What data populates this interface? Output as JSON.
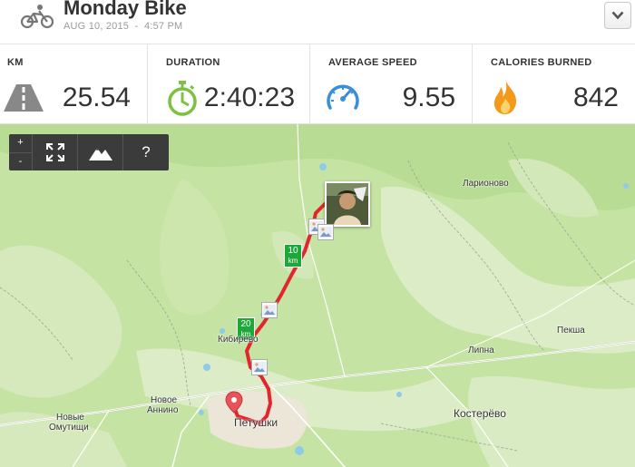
{
  "header": {
    "title": "Monday Bike",
    "date": "AUG 10, 2015",
    "separator": "-",
    "time": "4:57 PM"
  },
  "stats": [
    {
      "label": "KM",
      "value": "25.54",
      "icon": "road-icon"
    },
    {
      "label": "DURATION",
      "value": "2:40:23",
      "icon": "stopwatch-icon"
    },
    {
      "label": "AVERAGE SPEED",
      "value": "9.55",
      "icon": "speedometer-icon"
    },
    {
      "label": "CALORIES BURNED",
      "value": "842",
      "icon": "flame-icon"
    }
  ],
  "map": {
    "toolbar": {
      "zoom_in": "+",
      "zoom_out": "-",
      "fullscreen_icon": "fullscreen-icon",
      "terrain_icon": "mountain-icon",
      "help": "?"
    },
    "km_markers": [
      {
        "number": "10",
        "unit": "km"
      },
      {
        "number": "20",
        "unit": "km"
      }
    ],
    "towns": [
      "Ларионово",
      "Пекша",
      "Липна",
      "Кибирево",
      "Новое",
      "Аннино",
      "Новые",
      "Омутищи",
      "Петушки",
      "Костерёво"
    ]
  },
  "colors": {
    "route": "#e3262c",
    "km_marker": "#1fa83a",
    "icon_gray": "#888888",
    "icon_green": "#7cc142",
    "icon_blue": "#3a8fd6",
    "icon_orange": "#f39a1d",
    "toolbar_bg": "#3b3b3b"
  }
}
